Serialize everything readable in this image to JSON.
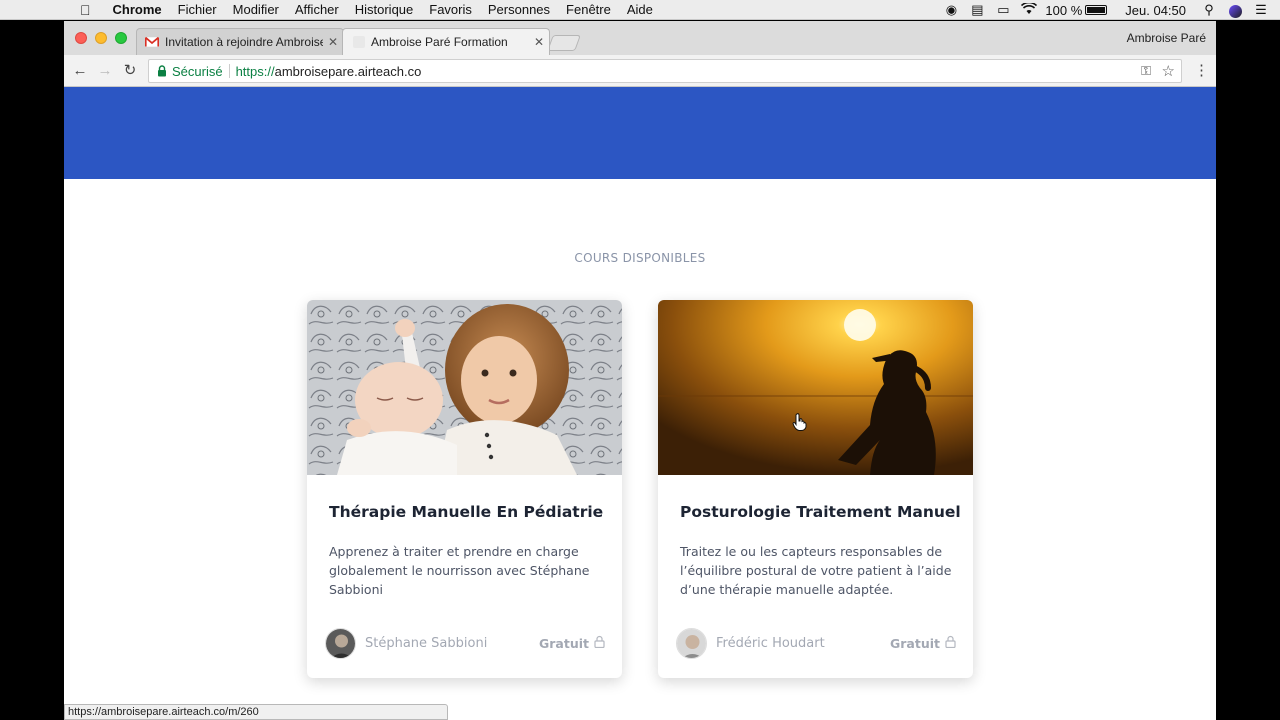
{
  "menubar": {
    "app_name": "Chrome",
    "items": [
      "Fichier",
      "Modifier",
      "Afficher",
      "Historique",
      "Favoris",
      "Personnes",
      "Fenêtre",
      "Aide"
    ],
    "battery": "100 %",
    "clock": "Jeu. 04:50"
  },
  "browser": {
    "tabs": [
      {
        "label": "Invitation à rejoindre Ambroise",
        "icon": "gmail-icon"
      },
      {
        "label": "Ambroise Paré Formation",
        "icon": "page-icon"
      }
    ],
    "profile": "Ambroise Paré",
    "address": {
      "secure_label": "Sécurisé",
      "scheme": "https://",
      "host": "ambroisepare.airteach.co"
    },
    "status_url": "https://ambroisepare.airteach.co/m/260"
  },
  "page": {
    "accent_color": "#2c56c3",
    "section_title": "COURS DISPONIBLES",
    "courses": [
      {
        "title": "Thérapie Manuelle En Pédiatrie",
        "description": "Apprenez à traiter et prendre en charge globalement le nourrisson avec Stéphane Sabbioni",
        "author": "Stéphane Sabbioni",
        "price": "Gratuit"
      },
      {
        "title": "Posturologie Traitement Manuel",
        "description": "Traitez le ou les capteurs responsables de l’équilibre postural de votre patient à l’aide d’une thérapie manuelle adaptée.",
        "author": "Frédéric Houdart",
        "price": "Gratuit"
      }
    ]
  }
}
